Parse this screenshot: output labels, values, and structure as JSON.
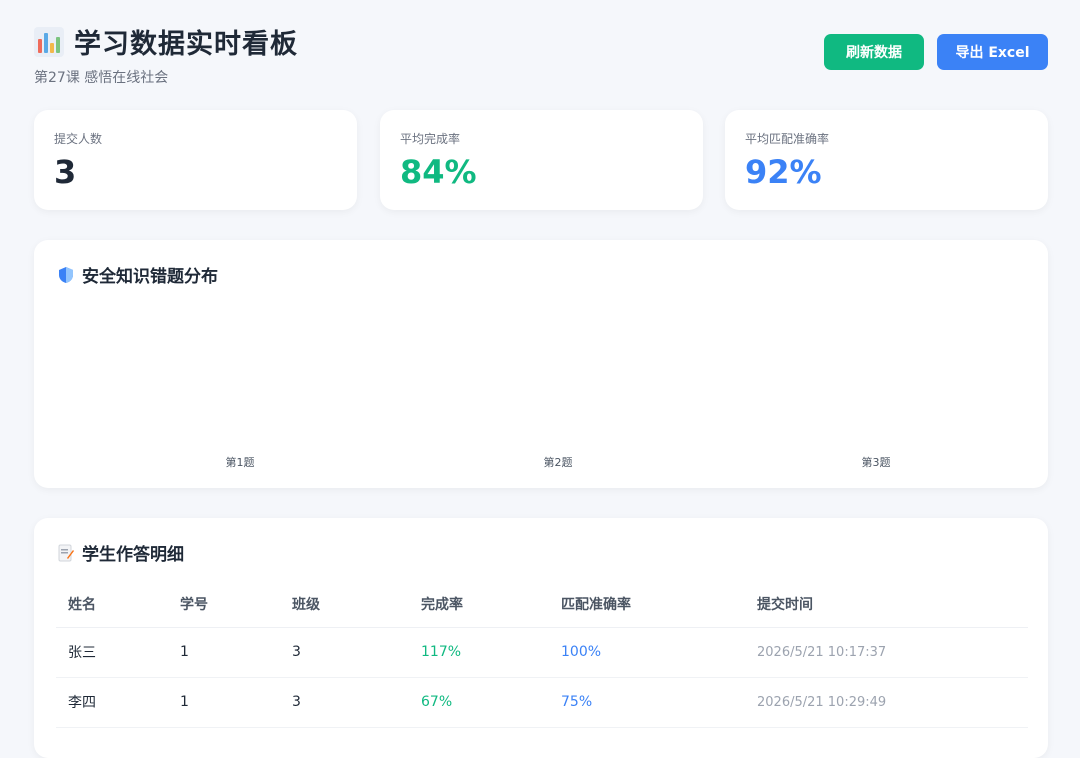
{
  "header": {
    "title": "学习数据实时看板",
    "subtitle": "第27课 感悟在线社会",
    "refresh_label": "刷新数据",
    "export_label": "导出 Excel"
  },
  "stats": [
    {
      "label": "提交人数",
      "value": "3",
      "color": "#1f2937"
    },
    {
      "label": "平均完成率",
      "value": "84%",
      "color": "#10b981"
    },
    {
      "label": "平均匹配准确率",
      "value": "92%",
      "color": "#3b82f6"
    }
  ],
  "chart": {
    "title": "安全知识错题分布"
  },
  "chart_data": {
    "type": "bar",
    "title": "安全知识错题分布",
    "categories": [
      "第1题",
      "第2题",
      "第3题"
    ],
    "values": [
      0,
      0,
      0
    ],
    "xlabel": "",
    "ylabel": ""
  },
  "table": {
    "title": "学生作答明细",
    "columns": [
      "姓名",
      "学号",
      "班级",
      "完成率",
      "匹配准确率",
      "提交时间"
    ],
    "rows": [
      {
        "name": "张三",
        "id": "1",
        "class": "3",
        "completion": "117%",
        "accuracy": "100%",
        "time": "2026/5/21 10:17:37"
      },
      {
        "name": "李四",
        "id": "1",
        "class": "3",
        "completion": "67%",
        "accuracy": "75%",
        "time": "2026/5/21 10:29:49"
      }
    ]
  },
  "colors": {
    "green": "#10b981",
    "blue": "#3b82f6"
  }
}
